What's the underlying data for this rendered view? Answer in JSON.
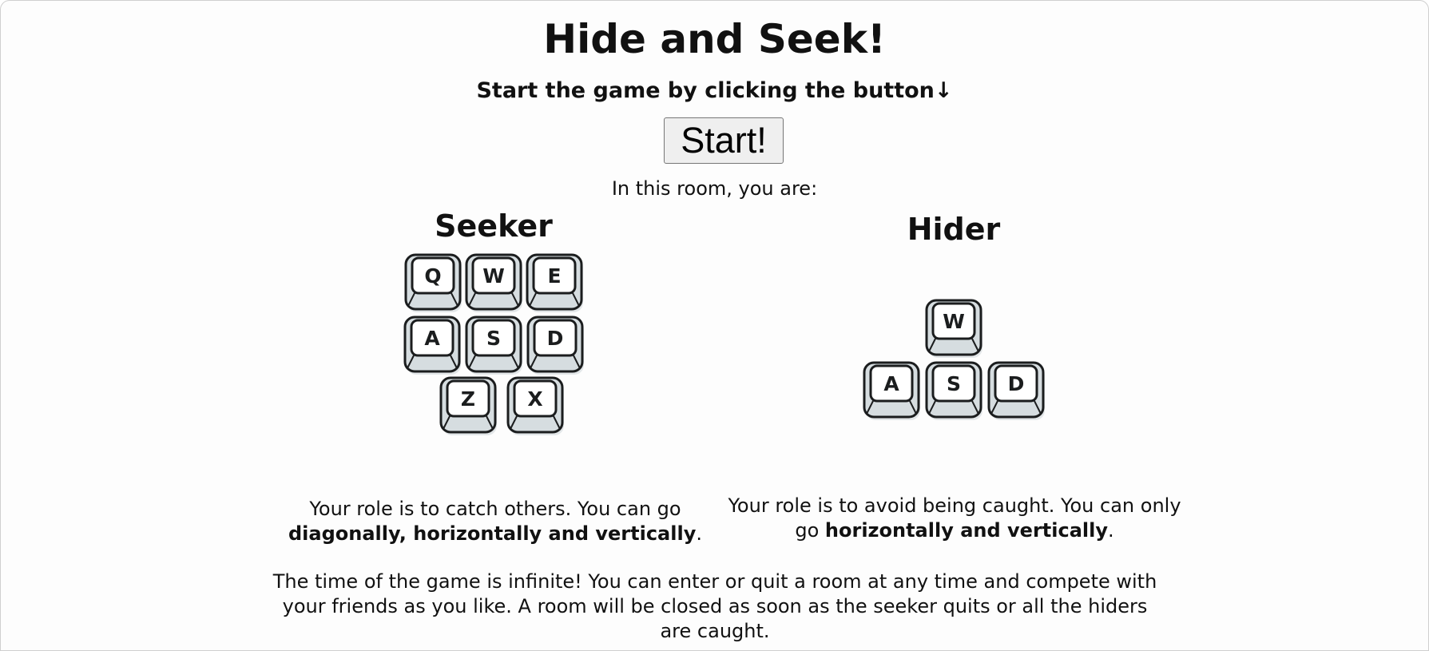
{
  "header": {
    "title": "Hide and Seek!",
    "subtitle": "Start the game by clicking the button↓",
    "start_label": "Start!",
    "room_line": "In this room, you are:"
  },
  "seeker": {
    "heading": "Seeker",
    "keys": [
      "Q",
      "W",
      "E",
      "A",
      "S",
      "D",
      "Z",
      "X"
    ],
    "desc_prefix": "Your role is to catch others. You can go",
    "desc_bold": "diagonally, horizontally and vertically",
    "desc_suffix": "."
  },
  "hider": {
    "heading": "Hider",
    "keys": [
      "W",
      "A",
      "S",
      "D"
    ],
    "desc_prefix": "Your role is to avoid being caught. You can only go",
    "desc_bold": "horizontally and vertically",
    "desc_suffix": "."
  },
  "footer": {
    "text": "The time of the game is infinite! You can enter or quit a room at any time and compete with your friends as you like. A room will be closed as soon as the seeker quits or all the hiders are caught."
  },
  "colors": {
    "key_face": "#ffffff",
    "key_side": "#d6dde0",
    "key_outline": "#1b1d1e",
    "key_shadow": "#e3e7e9"
  }
}
